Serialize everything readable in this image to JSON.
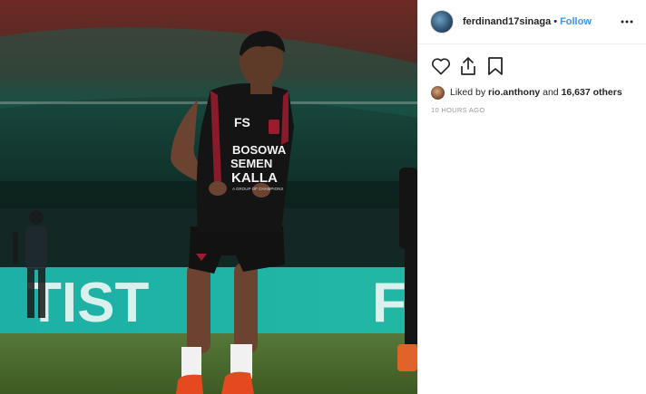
{
  "post": {
    "username": "ferdinand17sinaga",
    "separator": "•",
    "follow_label": "Follow",
    "more_icon": "ellipsis-icon",
    "actions": {
      "like_icon": "heart-icon",
      "share_icon": "share-icon",
      "save_icon": "bookmark-icon"
    },
    "likes": {
      "prefix": "Liked by",
      "liker": "rio.anthony",
      "conjunction": "and",
      "count_text": "16,637 others"
    },
    "timestamp": "10 HOURS AGO"
  },
  "photo": {
    "jersey_initials": "FS",
    "sponsor_line1": "BOSOWA",
    "sponsor_line2": "SEMEN",
    "sponsor_line3": "KALLA",
    "sponsor_tag": "A GROUP OF CHAMPIONS",
    "banner_text": "TIST",
    "banner_text_right": "F"
  },
  "colors": {
    "follow": "#3897f0",
    "text": "#262626",
    "muted": "#999999",
    "pitch": "#4a6e2c",
    "banner": "#1fb3a5",
    "jersey": "#151515",
    "jersey_accent": "#9b1c2e"
  }
}
